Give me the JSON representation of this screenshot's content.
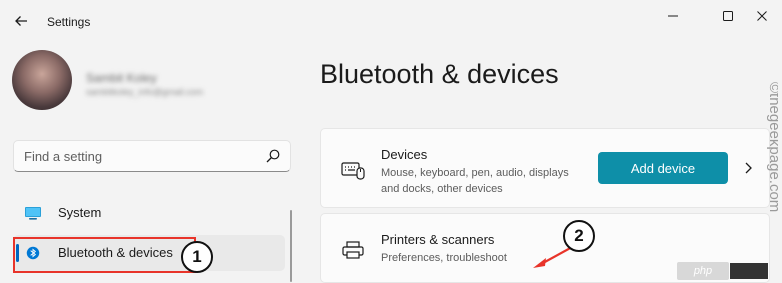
{
  "window": {
    "title": "Settings"
  },
  "user": {
    "name": "Sambit Koley",
    "email": "sambitkoley_info@gmail.com"
  },
  "search": {
    "placeholder": "Find a setting",
    "value": ""
  },
  "sidebar": {
    "items": [
      {
        "label": "System",
        "icon": "monitor-icon",
        "selected": false
      },
      {
        "label": "Bluetooth & devices",
        "icon": "bluetooth-icon",
        "selected": true
      }
    ]
  },
  "main": {
    "title": "Bluetooth & devices",
    "cards": [
      {
        "title": "Devices",
        "description": "Mouse, keyboard, pen, audio, displays and docks, other devices",
        "icon": "devices-icon",
        "action_label": "Add device"
      },
      {
        "title": "Printers & scanners",
        "description": "Preferences, troubleshoot",
        "icon": "printer-icon"
      }
    ]
  },
  "annotations": {
    "step1": "1",
    "step2": "2"
  },
  "watermark": {
    "text": "©thegeekpage.com"
  },
  "logo": {
    "text": "php"
  },
  "colors": {
    "accent": "#0067c0",
    "button": "#0e8fa8",
    "highlight": "#e8342a"
  }
}
